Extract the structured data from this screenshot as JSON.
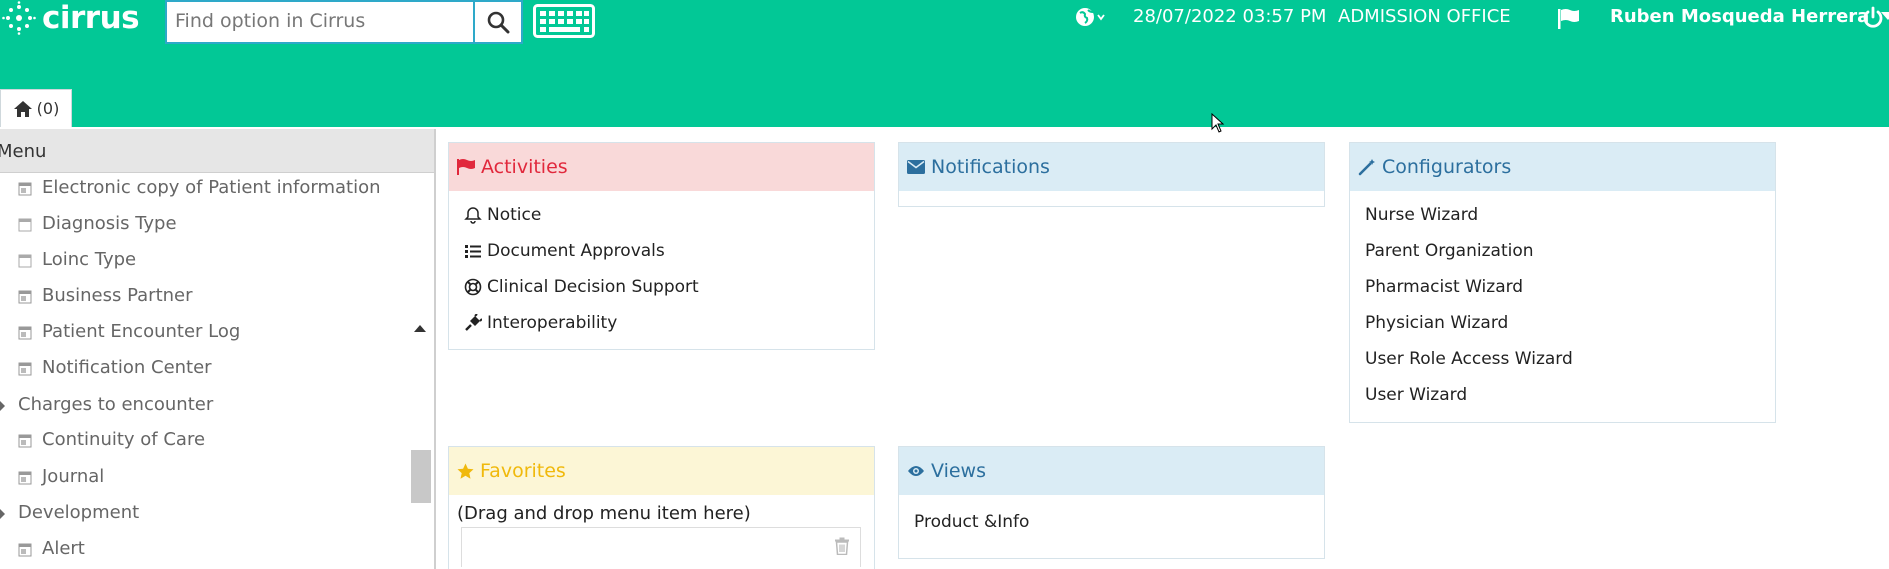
{
  "app": {
    "name": "cirrus"
  },
  "search": {
    "placeholder": "Find option in Cirrus"
  },
  "header": {
    "datetime": "28/07/2022 03:57 PM",
    "location": "ADMISSION OFFICE",
    "user": "Ruben Mosqueda Herrera"
  },
  "tabs": [
    {
      "label": "(0)",
      "icon": "home-icon"
    }
  ],
  "sidebar": {
    "title": "Menu",
    "items": [
      {
        "label": "Electronic copy of Patient information",
        "type": "leaf"
      },
      {
        "label": "Diagnosis Type",
        "type": "leaf-plain"
      },
      {
        "label": "Loinc Type",
        "type": "leaf-plain"
      },
      {
        "label": "Business Partner",
        "type": "leaf"
      },
      {
        "label": "Patient Encounter Log",
        "type": "leaf"
      },
      {
        "label": "Notification Center",
        "type": "leaf"
      },
      {
        "label": "Charges to encounter",
        "type": "branch"
      },
      {
        "label": "Continuity of Care",
        "type": "leaf"
      },
      {
        "label": "Journal",
        "type": "leaf"
      },
      {
        "label": "Development",
        "type": "branch"
      },
      {
        "label": "Alert",
        "type": "leaf"
      }
    ]
  },
  "panels": {
    "activities": {
      "title": "Activities",
      "items": [
        {
          "label": "Notice",
          "icon": "bell-icon"
        },
        {
          "label": "Document Approvals",
          "icon": "list-icon"
        },
        {
          "label": "Clinical Decision Support",
          "icon": "life-ring-icon"
        },
        {
          "label": "Interoperability",
          "icon": "plug-icon"
        }
      ]
    },
    "notifications": {
      "title": "Notifications"
    },
    "configurators": {
      "title": "Configurators",
      "items": [
        "Nurse Wizard",
        "Parent Organization",
        "Pharmacist Wizard",
        "Physician Wizard",
        "User Role Access Wizard",
        "User Wizard"
      ]
    },
    "favorites": {
      "title": "Favorites",
      "hint": "(Drag and drop menu item here)"
    },
    "views": {
      "title": "Views",
      "items": [
        "Product &Info"
      ]
    }
  },
  "colors": {
    "topbar": "#02c896",
    "activities_accent": "#e1283c",
    "blue_accent": "#2c6f9e",
    "favorites_accent": "#f0b90c"
  }
}
